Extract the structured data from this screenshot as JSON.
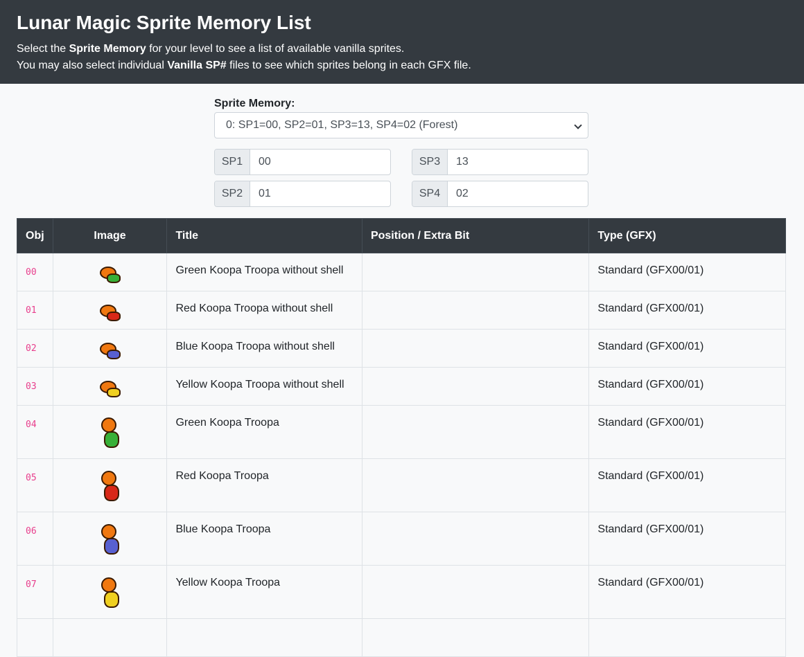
{
  "header": {
    "title": "Lunar Magic Sprite Memory List",
    "line1_pre": "Select the ",
    "line1_bold": "Sprite Memory",
    "line1_post": " for your level to see a list of available vanilla sprites.",
    "line2_pre": "You may also select individual ",
    "line2_bold": "Vanilla SP#",
    "line2_post": " files to see which sprites belong in each GFX file."
  },
  "memory": {
    "label": "Sprite Memory:",
    "selected": "0: SP1=00, SP2=01, SP3=13, SP4=02 (Forest)"
  },
  "sp": {
    "sp1_label": "SP1",
    "sp1_value": "00",
    "sp2_label": "SP2",
    "sp2_value": "01",
    "sp3_label": "SP3",
    "sp3_value": "13",
    "sp4_label": "SP4",
    "sp4_value": "02"
  },
  "table": {
    "headers": [
      "Obj",
      "Image",
      "Title",
      "Position / Extra Bit",
      "Type (GFX)"
    ],
    "rows": [
      {
        "obj": "00",
        "title": "Green Koopa Troopa without shell",
        "position": "",
        "type": "Standard (GFX00/01)",
        "color": "#38b038",
        "kind": "shell"
      },
      {
        "obj": "01",
        "title": "Red Koopa Troopa without shell",
        "position": "",
        "type": "Standard (GFX00/01)",
        "color": "#d82818",
        "kind": "shell"
      },
      {
        "obj": "02",
        "title": "Blue Koopa Troopa without shell",
        "position": "",
        "type": "Standard (GFX00/01)",
        "color": "#5860d0",
        "kind": "shell"
      },
      {
        "obj": "03",
        "title": "Yellow Koopa Troopa without shell",
        "position": "",
        "type": "Standard (GFX00/01)",
        "color": "#f0d020",
        "kind": "shell"
      },
      {
        "obj": "04",
        "title": "Green Koopa Troopa",
        "position": "",
        "type": "Standard (GFX00/01)",
        "color": "#38b038",
        "kind": "koopa"
      },
      {
        "obj": "05",
        "title": "Red Koopa Troopa",
        "position": "",
        "type": "Standard (GFX00/01)",
        "color": "#d82818",
        "kind": "koopa"
      },
      {
        "obj": "06",
        "title": "Blue Koopa Troopa",
        "position": "",
        "type": "Standard (GFX00/01)",
        "color": "#5860d0",
        "kind": "koopa"
      },
      {
        "obj": "07",
        "title": "Yellow Koopa Troopa",
        "position": "",
        "type": "Standard (GFX00/01)",
        "color": "#f0d020",
        "kind": "koopa"
      },
      {
        "obj": "",
        "title": "",
        "position": "",
        "type": "",
        "color": "",
        "kind": "partial"
      }
    ]
  },
  "colors": {
    "header_bg": "#343a40",
    "obj_code": "#e83e8c",
    "sprite_skin": "#f07810"
  }
}
